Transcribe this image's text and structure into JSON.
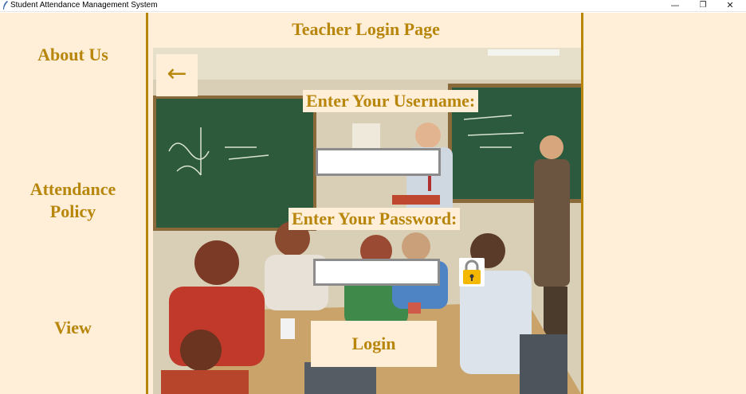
{
  "window": {
    "title": "Student Attendance Management System",
    "minimize_glyph": "—",
    "maximize_glyph": "❐",
    "close_glyph": "✕"
  },
  "sidebar": {
    "items": [
      {
        "label": "About Us"
      },
      {
        "label": "Attendance Policy"
      },
      {
        "label": "View"
      }
    ]
  },
  "main": {
    "title": "Teacher Login Page",
    "back_glyph": "←",
    "username_label": "Enter Your Username:",
    "username_value": "",
    "password_label": "Enter Your Password:",
    "password_value": "",
    "login_label": "Login",
    "lock_icon": "padlock-icon"
  },
  "colors": {
    "background": "#ffefd9",
    "accent": "#b8860b",
    "chalkboard": "#2e5a3c"
  }
}
